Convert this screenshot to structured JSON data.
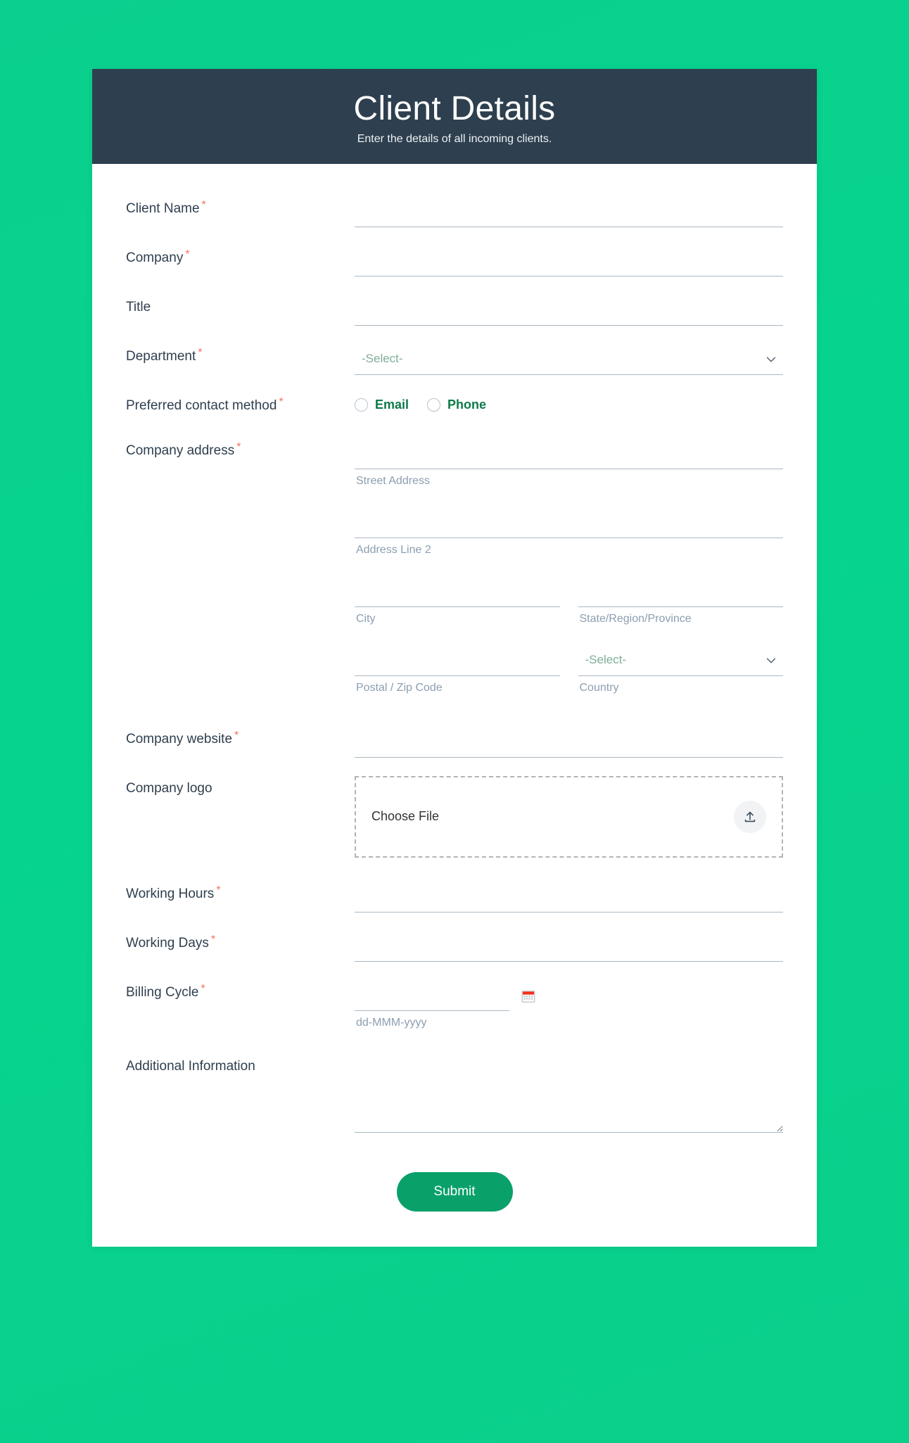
{
  "theme": {
    "page_background": "#0ad18c",
    "header_background": "#2e3f4f",
    "accent_green": "#0aa06a",
    "required_marker_color": "#f8705f",
    "placeholder_color": "#9aabbb",
    "select_placeholder_color": "#7fae97",
    "radio_label_color": "#0c7a49"
  },
  "header": {
    "title": "Client Details",
    "subtitle": "Enter the details of all incoming clients."
  },
  "fields": {
    "client_name": {
      "label": "Client Name",
      "required_marker": "*",
      "value": "",
      "placeholder": ""
    },
    "company": {
      "label": "Company",
      "required_marker": "*",
      "value": "",
      "placeholder": ""
    },
    "title": {
      "label": "Title",
      "required_marker": "",
      "value": "",
      "placeholder": ""
    },
    "department": {
      "label": "Department",
      "required_marker": "*",
      "selected": "-Select-",
      "chevron_icon": "chevron-down-icon"
    },
    "contact_method": {
      "label": "Preferred contact method",
      "required_marker": "*",
      "options": [
        {
          "label": "Email",
          "selected": false
        },
        {
          "label": "Phone",
          "selected": false
        }
      ]
    },
    "company_address": {
      "label": "Company address",
      "required_marker": "*",
      "street_address": {
        "sub_label": "Street Address",
        "value": ""
      },
      "address_line_2": {
        "sub_label": "Address Line 2",
        "value": ""
      },
      "city": {
        "sub_label": "City",
        "value": ""
      },
      "state": {
        "sub_label": "State/Region/Province",
        "value": ""
      },
      "postal_code": {
        "sub_label": "Postal / Zip Code",
        "value": ""
      },
      "country": {
        "sub_label": "Country",
        "selected": "-Select-",
        "chevron_icon": "chevron-down-icon"
      }
    },
    "company_website": {
      "label": "Company website",
      "required_marker": "*",
      "value": "",
      "placeholder": ""
    },
    "company_logo": {
      "label": "Company logo",
      "required_marker": "",
      "choose_file_label": "Choose File",
      "upload_icon": "upload-icon"
    },
    "working_hours": {
      "label": "Working Hours",
      "required_marker": "*",
      "value": "",
      "placeholder": ""
    },
    "working_days": {
      "label": "Working Days",
      "required_marker": "*",
      "value": "",
      "placeholder": ""
    },
    "billing_cycle": {
      "label": "Billing Cycle",
      "required_marker": "*",
      "value": "",
      "format_hint": "dd-MMM-yyyy",
      "calendar_icon": "calendar-icon"
    },
    "additional_information": {
      "label": "Additional Information",
      "required_marker": "",
      "value": "",
      "placeholder": ""
    }
  },
  "actions": {
    "submit_label": "Submit"
  }
}
